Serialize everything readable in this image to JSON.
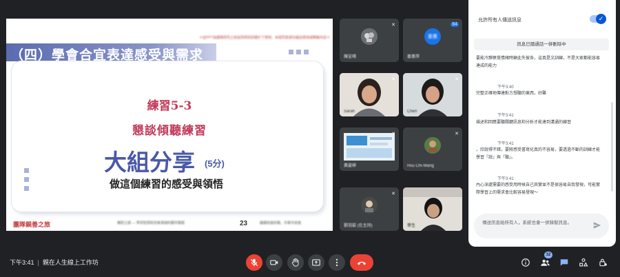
{
  "slide": {
    "note": "＊此PPT為團隊研究之用途而特別授權於下使用，未經同意請勿擅自使用或轉載內容＊",
    "title": "（四）學會合宜表達感受與需求",
    "exercise": "練習5-3",
    "exercise_title": "懇談傾聽練習",
    "share_heading": "大組分享",
    "share_minutes": "(5分)",
    "body": "做這個練習的感受與領悟",
    "footer_logo": "團隊親善之旅",
    "footer_center": "親密之旅 — 學習智慧和完美溝通的艱辛路程",
    "page_number": "23",
    "footer_right": "繼續前進的路，手牽手前進"
  },
  "participants": [
    {
      "name": "陳宜晴",
      "avatar": "image"
    },
    {
      "name": "姜惠萍",
      "avatar": "initials",
      "initials": "姜惠",
      "color": "#1a73e8",
      "badge": "84"
    },
    {
      "name": "Sarah",
      "avatar": "video"
    },
    {
      "name": "Chen",
      "avatar": "video"
    },
    {
      "name": "黃姿婷",
      "avatar": "thumbnail"
    },
    {
      "name": "Hsu Chi-Wang",
      "avatar": "image"
    },
    {
      "name": "劉羽宸 (在主持)",
      "avatar": "image"
    },
    {
      "name": "學生",
      "avatar": "video"
    }
  ],
  "chat": {
    "allow_label": "允許所有人傳送訊息",
    "pinned_label": "訊息已隨通話一併刪除中",
    "messages": [
      {
        "time": "",
        "text": "要能冷靜察覺情緒時顧此失彼各，這真是文訓練，不是大家都能容易達成的能力"
      },
      {
        "time": "下午3:40",
        "text": "完整正確地傳達對方想聽的東西，好難"
      },
      {
        "time": "下午3:41",
        "text": "描述和回應要聽關鍵訊息和分析才能達到溝通的練習"
      },
      {
        "time": "下午3:41",
        "text": "，欣說得不錯，要將感受書寫化真的不容易，要透過不斷的訓練才能學習『說』與『聽』。"
      },
      {
        "time": "下午3:41",
        "text": "內心深處需要的感受用時候自己其實並不是很容易自我發現，可能實際學習上的需求會比較容易發現～"
      }
    ],
    "composer_placeholder": "傳送訊息給所有人，系統也會一併錄製訊息。"
  },
  "bottom": {
    "time": "下午3:41",
    "meeting_name": "親在人生線上工作坊",
    "participant_count": "32"
  },
  "colors": {
    "background": "#202124",
    "end_call": "#ea4335",
    "accent": "#8ab4f8",
    "slide_title": "#5a6bb0",
    "slide_red": "#c23a5a"
  }
}
